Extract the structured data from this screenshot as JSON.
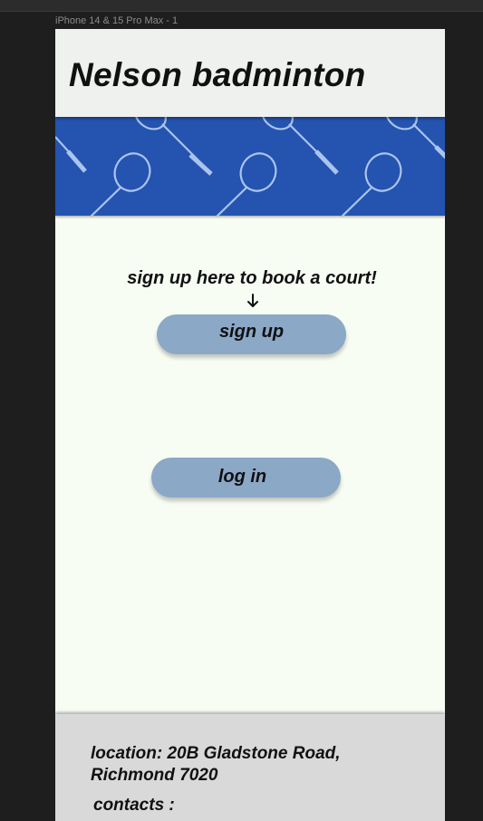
{
  "editor": {
    "frame_label": "iPhone 14 & 15 Pro Max - 1"
  },
  "header": {
    "title": "Nelson badminton"
  },
  "banner": {
    "icon": "badminton-racket-pattern",
    "background_color": "#2453b0"
  },
  "main": {
    "tagline": "sign up here to book a court!",
    "arrow_icon": "arrow-down-icon",
    "signup_label": "sign up",
    "login_label": "log in"
  },
  "footer": {
    "location_line1": "location: 20B Gladstone Road,",
    "location_line2": "Richmond 7020",
    "contacts_label": "contacts :"
  },
  "colors": {
    "button": "#8ba8c7",
    "page_background": "#f7fdf3",
    "header_background": "#eef1ee",
    "footer_background": "#d9d9d9"
  }
}
